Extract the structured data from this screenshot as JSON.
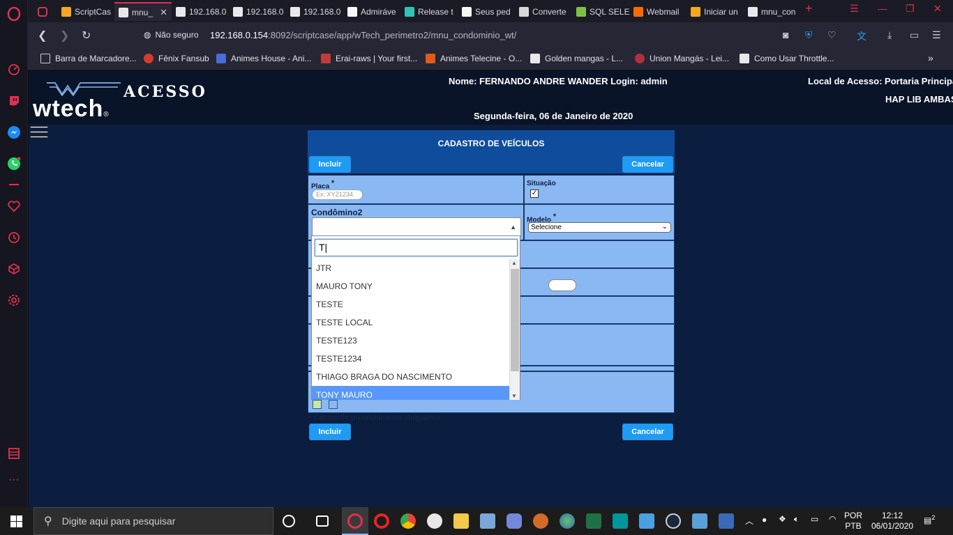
{
  "browser": {
    "tabs": [
      {
        "label": "",
        "color": "#e0324f"
      },
      {
        "label": "ScriptCas",
        "color": "#f5a623"
      },
      {
        "label": "mnu_",
        "color": "#e8e8e8"
      },
      {
        "label": "192.168.0",
        "color": "#e8e8e8"
      },
      {
        "label": "192.168.0",
        "color": "#e8e8e8"
      },
      {
        "label": "192.168.0",
        "color": "#e8e8e8"
      },
      {
        "label": "Admiráve",
        "color": "#f7f7f7"
      },
      {
        "label": "Release t",
        "color": "#2ec4b6"
      },
      {
        "label": "Seus ped",
        "color": "#f7f7f7"
      },
      {
        "label": "Converte",
        "color": "#d8d8d8"
      },
      {
        "label": "SQL SELE",
        "color": "#7cc242"
      },
      {
        "label": "Webmail",
        "color": "#ff6a00"
      },
      {
        "label": "Iniciar un",
        "color": "#f5a623"
      },
      {
        "label": "mnu_con",
        "color": "#e8e8e8"
      }
    ],
    "tab_close": "✕",
    "new_tab": "+",
    "insecure_label": "Não seguro",
    "url_host": "192.168.0.154",
    "url_rest": ":8092/scriptcase/app/wTech_perimetro2/mnu_condominio_wt/",
    "bookmarks": [
      {
        "label": "Barra de Marcadore...",
        "color": "#cfcfd8"
      },
      {
        "label": "Fênix Fansub",
        "color": "#d63a2a"
      },
      {
        "label": "Animes House - Ani...",
        "color": "#4a6bd8"
      },
      {
        "label": "Erai-raws | Your first...",
        "color": "#c23a3a"
      },
      {
        "label": "Animes Telecine - O...",
        "color": "#e05a1a"
      },
      {
        "label": "Golden mangas - L...",
        "color": "#e8e8e8"
      },
      {
        "label": "Union Mangás - Lei...",
        "color": "#b03040"
      },
      {
        "label": "Como Usar Throttle...",
        "color": "#e8e8e8"
      }
    ],
    "bookmarks_more": "»"
  },
  "header": {
    "logo": "wtech",
    "logo_mark": "®",
    "title": "ACESSO",
    "user_line": "Nome: FERNANDO ANDRE WANDER Login: admin",
    "local_line": "Local de Acesso: Portaria Principal",
    "site_line": "HAP LIB AMBAS",
    "date_line": "Segunda-feira, 06 de Janeiro de 2020"
  },
  "form": {
    "title": "CADASTRO DE VEÍCULOS",
    "incluir_label": "Incluir",
    "cancelar_label": "Cancelar",
    "placa_label": "Placa",
    "required_mark": "*",
    "placa_placeholder": "Ex: XYZ1234",
    "situacao_label": "Situação",
    "situacao_checked": "✓",
    "condomino_label": "Condômino2",
    "modelo_label": "Modelo",
    "modelo_value": "Selecione",
    "footnote": "* Campo de preenchimento obrigatório"
  },
  "dropdown": {
    "search_value": "T|",
    "items": [
      "JTR",
      "MAURO TONY",
      "TESTE",
      "TESTE LOCAL",
      "TESTE123",
      "TESTE1234",
      "THIAGO BRAGA DO NASCIMENTO",
      "TONY MAURO"
    ],
    "highlighted_index": 7
  },
  "taskbar": {
    "search_placeholder": "Digite aqui para pesquisar",
    "lang_top": "POR",
    "lang_bottom": "PTB",
    "time": "12:12",
    "date": "06/01/2020",
    "notifications": "2"
  }
}
